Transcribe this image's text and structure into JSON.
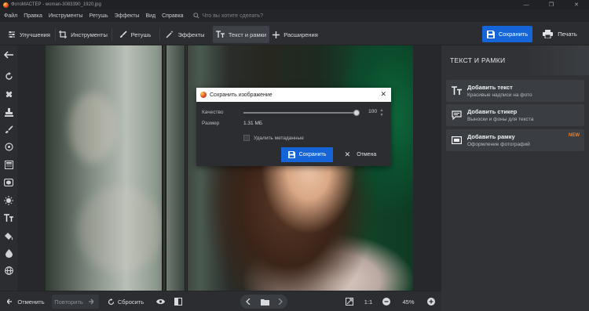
{
  "window": {
    "title": "ФотоМАСТЕР - woman-3083390_1920.jpg",
    "minimize": "—",
    "maximize": "❐",
    "close": "✕"
  },
  "menu": {
    "items": [
      "Файл",
      "Правка",
      "Инструменты",
      "Ретушь",
      "Эффекты",
      "Вид",
      "Справка"
    ],
    "search_placeholder": "Что вы хотите сделать?"
  },
  "toolbar": {
    "tabs": [
      {
        "label": "Улучшения",
        "icon": "sliders-icon",
        "active": false
      },
      {
        "label": "Инструменты",
        "icon": "crop-icon",
        "active": false
      },
      {
        "label": "Ретушь",
        "icon": "brush-icon",
        "active": false
      },
      {
        "label": "Эффекты",
        "icon": "magic-wand-icon",
        "active": false
      },
      {
        "label": "Текст и рамки",
        "icon": "text-icon",
        "active": true
      },
      {
        "label": "Расширения",
        "icon": "plus-icon",
        "active": false
      }
    ],
    "save_label": "Сохранить",
    "print_label": "Печать"
  },
  "left_tools": [
    "back-arrow-icon",
    "rotate-icon",
    "heal-icon",
    "stamp-icon",
    "brush-icon",
    "radial-icon",
    "gradient-icon",
    "vignette-icon",
    "sun-icon",
    "text-tool-icon",
    "fill-icon",
    "liquify-icon",
    "globe-icon"
  ],
  "right_panel": {
    "title": "ТЕКСТ И РАМКИ",
    "items": [
      {
        "title": "Добавить текст",
        "desc": "Красивые надписи на фото",
        "icon": "text-icon",
        "badge": ""
      },
      {
        "title": "Добавить стикер",
        "desc": "Выноски и фоны для текста",
        "icon": "sticker-icon",
        "badge": ""
      },
      {
        "title": "Добавить рамку",
        "desc": "Оформление фотографий",
        "icon": "frame-icon",
        "badge": "NEW"
      }
    ]
  },
  "dialog": {
    "title": "Сохранить изображение",
    "quality_label": "Качество",
    "quality_value": "100",
    "quality_level": 1.0,
    "size_label": "Размер",
    "size_value": "1.31 МБ",
    "strip_metadata_label": "Удалить метаданные",
    "strip_metadata_checked": false,
    "save_label": "Сохранить",
    "cancel_label": "Отмена"
  },
  "bottom": {
    "undo_label": "Отменить",
    "redo_label": "Повторить",
    "reset_label": "Сбросить",
    "ratio_label": "1:1",
    "zoom_value": "45%"
  },
  "colors": {
    "accent": "#1565d8",
    "new_badge": "#ff7a1a",
    "panel_bg": "#303236",
    "app_bg": "#2b2d31"
  }
}
